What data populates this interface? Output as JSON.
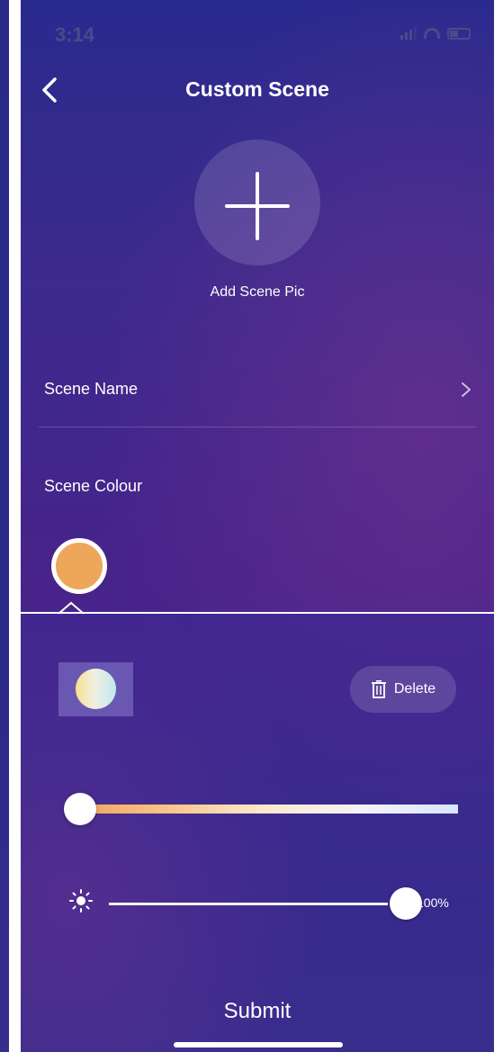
{
  "status_bar": {
    "time": "3:14",
    "location_icon": "location-arrow-icon"
  },
  "header": {
    "title": "Custom Scene",
    "back_icon": "chevron-left-icon"
  },
  "add_pic": {
    "label": "Add Scene Pic",
    "icon": "plus-icon"
  },
  "scene_name": {
    "label": "Scene Name",
    "icon": "chevron-right-icon"
  },
  "scene_colour": {
    "label": "Scene Colour",
    "swatch_color": "#eea65a"
  },
  "editor": {
    "delete_label": "Delete",
    "delete_icon": "trash-icon",
    "temp_slider_level": 0,
    "brightness_level": 100,
    "brightness_text": "100%",
    "brightness_icon": "sun-icon"
  },
  "footer": {
    "submit_label": "Submit"
  },
  "colors": {
    "accent": "#eea65a",
    "panel_swatch_bg": "#6a57b2"
  }
}
